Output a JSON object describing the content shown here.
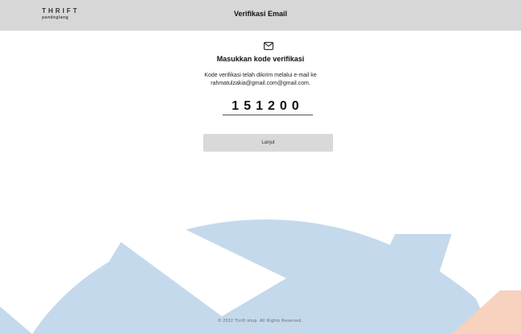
{
  "header": {
    "logo_main": "THRIFT",
    "logo_sub": "pandeglang",
    "title": "Verifikasi Email"
  },
  "main": {
    "icon": "mail-icon",
    "heading": "Masukkan kode verifikasi",
    "info_line1": "Kode verifikasi telah dikirim melalui e-mail ke",
    "info_line2": "rahmatulzakia@gmail.com@gmail.com.",
    "code_value": "151200",
    "button_label": "Lanjut"
  },
  "footer": {
    "copyright": "© 2022 Thrift shop. All Rights Reserved."
  },
  "colors": {
    "header_bg": "#d7d7d7",
    "button_bg": "#d9d9d9",
    "watermark_blue": "#c5d9ec",
    "watermark_orange": "#f6d2bf"
  }
}
